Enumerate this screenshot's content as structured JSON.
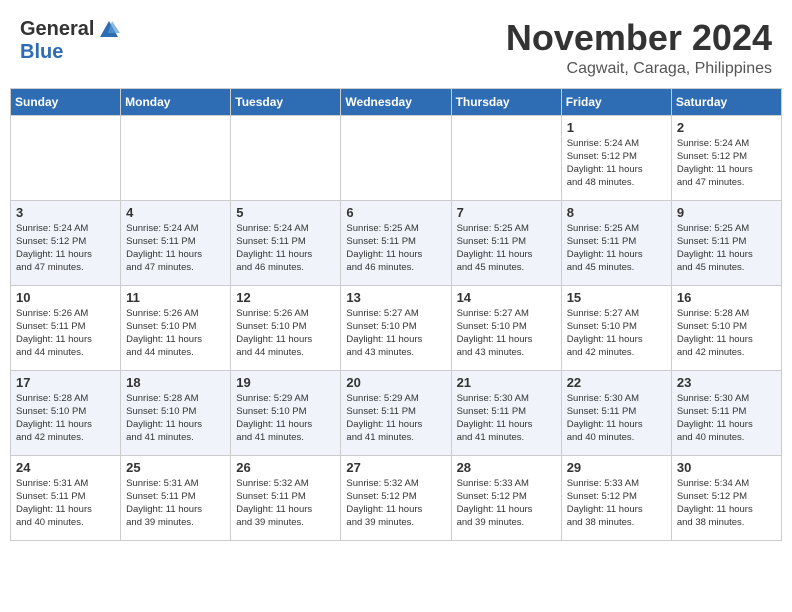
{
  "header": {
    "logo": {
      "general": "General",
      "blue": "Blue"
    },
    "month": "November 2024",
    "location": "Cagwait, Caraga, Philippines"
  },
  "days_of_week": [
    "Sunday",
    "Monday",
    "Tuesday",
    "Wednesday",
    "Thursday",
    "Friday",
    "Saturday"
  ],
  "weeks": [
    [
      {
        "day": "",
        "info": ""
      },
      {
        "day": "",
        "info": ""
      },
      {
        "day": "",
        "info": ""
      },
      {
        "day": "",
        "info": ""
      },
      {
        "day": "",
        "info": ""
      },
      {
        "day": "1",
        "info": "Sunrise: 5:24 AM\nSunset: 5:12 PM\nDaylight: 11 hours\nand 48 minutes."
      },
      {
        "day": "2",
        "info": "Sunrise: 5:24 AM\nSunset: 5:12 PM\nDaylight: 11 hours\nand 47 minutes."
      }
    ],
    [
      {
        "day": "3",
        "info": "Sunrise: 5:24 AM\nSunset: 5:12 PM\nDaylight: 11 hours\nand 47 minutes."
      },
      {
        "day": "4",
        "info": "Sunrise: 5:24 AM\nSunset: 5:11 PM\nDaylight: 11 hours\nand 47 minutes."
      },
      {
        "day": "5",
        "info": "Sunrise: 5:24 AM\nSunset: 5:11 PM\nDaylight: 11 hours\nand 46 minutes."
      },
      {
        "day": "6",
        "info": "Sunrise: 5:25 AM\nSunset: 5:11 PM\nDaylight: 11 hours\nand 46 minutes."
      },
      {
        "day": "7",
        "info": "Sunrise: 5:25 AM\nSunset: 5:11 PM\nDaylight: 11 hours\nand 45 minutes."
      },
      {
        "day": "8",
        "info": "Sunrise: 5:25 AM\nSunset: 5:11 PM\nDaylight: 11 hours\nand 45 minutes."
      },
      {
        "day": "9",
        "info": "Sunrise: 5:25 AM\nSunset: 5:11 PM\nDaylight: 11 hours\nand 45 minutes."
      }
    ],
    [
      {
        "day": "10",
        "info": "Sunrise: 5:26 AM\nSunset: 5:11 PM\nDaylight: 11 hours\nand 44 minutes."
      },
      {
        "day": "11",
        "info": "Sunrise: 5:26 AM\nSunset: 5:10 PM\nDaylight: 11 hours\nand 44 minutes."
      },
      {
        "day": "12",
        "info": "Sunrise: 5:26 AM\nSunset: 5:10 PM\nDaylight: 11 hours\nand 44 minutes."
      },
      {
        "day": "13",
        "info": "Sunrise: 5:27 AM\nSunset: 5:10 PM\nDaylight: 11 hours\nand 43 minutes."
      },
      {
        "day": "14",
        "info": "Sunrise: 5:27 AM\nSunset: 5:10 PM\nDaylight: 11 hours\nand 43 minutes."
      },
      {
        "day": "15",
        "info": "Sunrise: 5:27 AM\nSunset: 5:10 PM\nDaylight: 11 hours\nand 42 minutes."
      },
      {
        "day": "16",
        "info": "Sunrise: 5:28 AM\nSunset: 5:10 PM\nDaylight: 11 hours\nand 42 minutes."
      }
    ],
    [
      {
        "day": "17",
        "info": "Sunrise: 5:28 AM\nSunset: 5:10 PM\nDaylight: 11 hours\nand 42 minutes."
      },
      {
        "day": "18",
        "info": "Sunrise: 5:28 AM\nSunset: 5:10 PM\nDaylight: 11 hours\nand 41 minutes."
      },
      {
        "day": "19",
        "info": "Sunrise: 5:29 AM\nSunset: 5:10 PM\nDaylight: 11 hours\nand 41 minutes."
      },
      {
        "day": "20",
        "info": "Sunrise: 5:29 AM\nSunset: 5:11 PM\nDaylight: 11 hours\nand 41 minutes."
      },
      {
        "day": "21",
        "info": "Sunrise: 5:30 AM\nSunset: 5:11 PM\nDaylight: 11 hours\nand 41 minutes."
      },
      {
        "day": "22",
        "info": "Sunrise: 5:30 AM\nSunset: 5:11 PM\nDaylight: 11 hours\nand 40 minutes."
      },
      {
        "day": "23",
        "info": "Sunrise: 5:30 AM\nSunset: 5:11 PM\nDaylight: 11 hours\nand 40 minutes."
      }
    ],
    [
      {
        "day": "24",
        "info": "Sunrise: 5:31 AM\nSunset: 5:11 PM\nDaylight: 11 hours\nand 40 minutes."
      },
      {
        "day": "25",
        "info": "Sunrise: 5:31 AM\nSunset: 5:11 PM\nDaylight: 11 hours\nand 39 minutes."
      },
      {
        "day": "26",
        "info": "Sunrise: 5:32 AM\nSunset: 5:11 PM\nDaylight: 11 hours\nand 39 minutes."
      },
      {
        "day": "27",
        "info": "Sunrise: 5:32 AM\nSunset: 5:12 PM\nDaylight: 11 hours\nand 39 minutes."
      },
      {
        "day": "28",
        "info": "Sunrise: 5:33 AM\nSunset: 5:12 PM\nDaylight: 11 hours\nand 39 minutes."
      },
      {
        "day": "29",
        "info": "Sunrise: 5:33 AM\nSunset: 5:12 PM\nDaylight: 11 hours\nand 38 minutes."
      },
      {
        "day": "30",
        "info": "Sunrise: 5:34 AM\nSunset: 5:12 PM\nDaylight: 11 hours\nand 38 minutes."
      }
    ]
  ]
}
